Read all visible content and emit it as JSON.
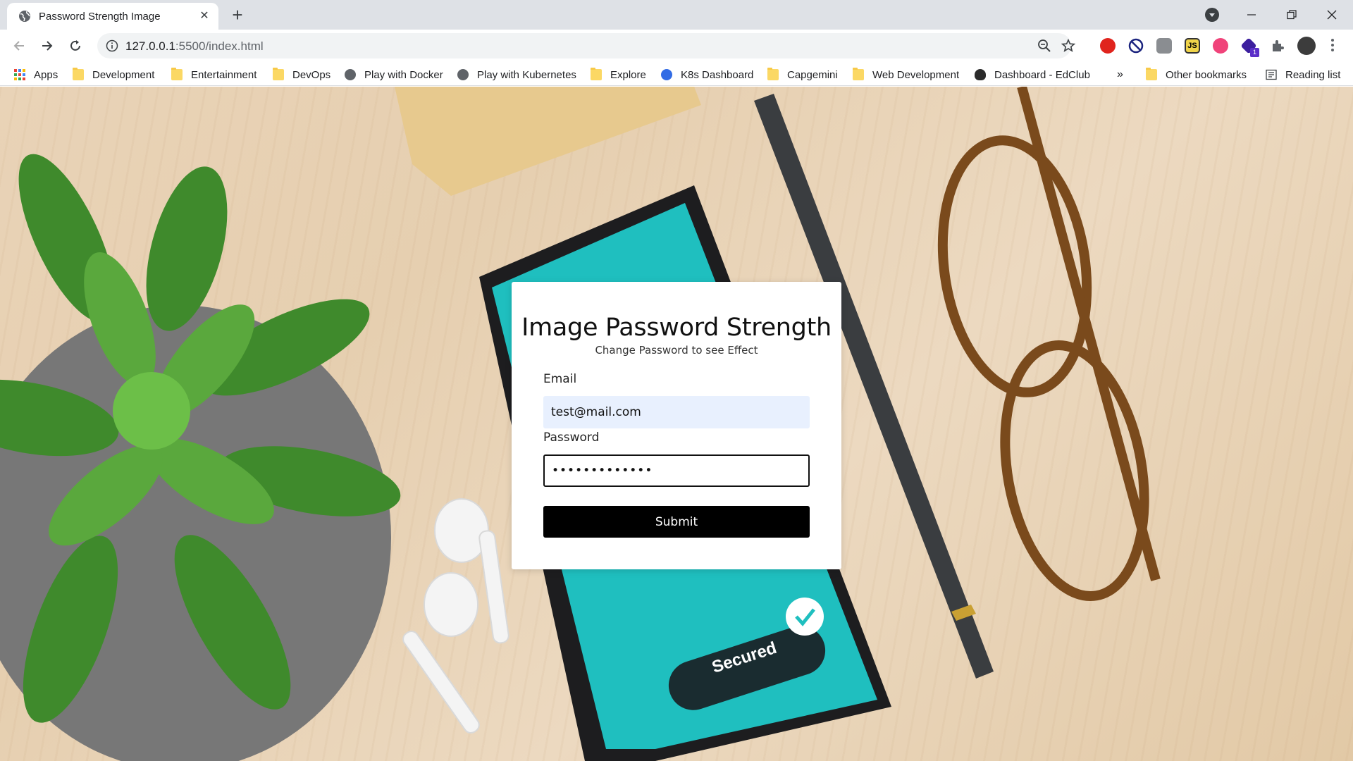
{
  "browser": {
    "tab_title": "Password Strength Image",
    "url_host": "127.0.0.1",
    "url_path": ":5500/index.html",
    "bookmarks": [
      {
        "label": "Apps",
        "icon": "apps-grid-icon"
      },
      {
        "label": "Development",
        "icon": "folder-icon"
      },
      {
        "label": "Entertainment",
        "icon": "folder-icon"
      },
      {
        "label": "DevOps",
        "icon": "folder-icon"
      },
      {
        "label": "Play with Docker",
        "icon": "globe-icon"
      },
      {
        "label": "Play with Kubernetes",
        "icon": "globe-icon"
      },
      {
        "label": "Explore",
        "icon": "folder-icon"
      },
      {
        "label": "K8s Dashboard",
        "icon": "kubernetes-icon"
      },
      {
        "label": "Capgemini",
        "icon": "folder-icon"
      },
      {
        "label": "Web Development",
        "icon": "folder-icon"
      },
      {
        "label": "Dashboard - EdClub",
        "icon": "edclub-icon"
      }
    ],
    "overflow_label": "»",
    "other_bookmarks": "Other bookmarks",
    "reading_list": "Reading list",
    "extension_badge": "1"
  },
  "form": {
    "title": "Image Password Strength",
    "subtitle": "Change Password to see Effect",
    "email_label": "Email",
    "email_value": "test@mail.com",
    "password_label": "Password",
    "password_value": "•••••••••••••",
    "submit_label": "Submit"
  },
  "background": {
    "phone_badge_text": "Secured"
  },
  "colors": {
    "accent_black": "#000000",
    "email_autofill_bg": "#e8f0fe",
    "tabstrip_bg": "#dee1e6",
    "phone_screen": "#1fbfbf"
  }
}
